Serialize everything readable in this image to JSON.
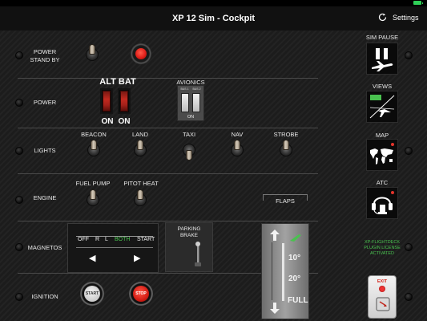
{
  "header": {
    "title": "XP 12 Sim - Cockpit",
    "settings_label": "Settings"
  },
  "sections": {
    "power_standby": "POWER\nSTAND BY",
    "power": "POWER",
    "lights": "LIGHTS",
    "engine": "ENGINE",
    "magnetos": "MAGNETOS",
    "ignition": "IGNITION"
  },
  "power": {
    "alt_bat_label": "ALT BAT",
    "alt_state": "ON",
    "bat_state": "ON",
    "avionics_label": "AVIONICS",
    "bus1_label": "BUS 1",
    "bus2_label": "BUS 2",
    "avionics_state": "ON"
  },
  "lights": {
    "beacon": "BEACON",
    "land": "LAND",
    "taxi": "TAXI",
    "nav": "NAV",
    "strobe": "STROBE"
  },
  "engine": {
    "fuel_pump": "FUEL PUMP",
    "pitot_heat": "PITOT HEAT"
  },
  "magnetos": {
    "positions": [
      "OFF",
      "R",
      "L",
      "BOTH",
      "START"
    ],
    "selected": "BOTH",
    "left_arrow": "◀",
    "right_arrow": "▶"
  },
  "parking_brake": {
    "label": "PARKING\nBRAKE"
  },
  "ignition": {
    "start_label": "START",
    "stop_label": "STOP"
  },
  "flaps": {
    "label": "FLAPS",
    "ten": "10°",
    "twenty": "20°",
    "full": "FULL"
  },
  "right_panel": {
    "sim_pause": "SIM PAUSE",
    "views": "VIEWS",
    "map": "MAP",
    "atc": "ATC",
    "license_note": "XP-FLIGHTDECK\nPLUGIN LICENSE\nACTIVATED",
    "exit_label": "EXIT"
  },
  "colors": {
    "accent_green": "#49c24f",
    "alert_red": "#e3342b",
    "panel_background": "#1b1b1b"
  },
  "icons": {
    "refresh": "refresh-icon",
    "sim_pause": "pause-airplane-icon",
    "views": "cockpit-view-icon",
    "map": "world-map-icon",
    "atc": "headset-icon",
    "exit": "exit-door-icon"
  }
}
